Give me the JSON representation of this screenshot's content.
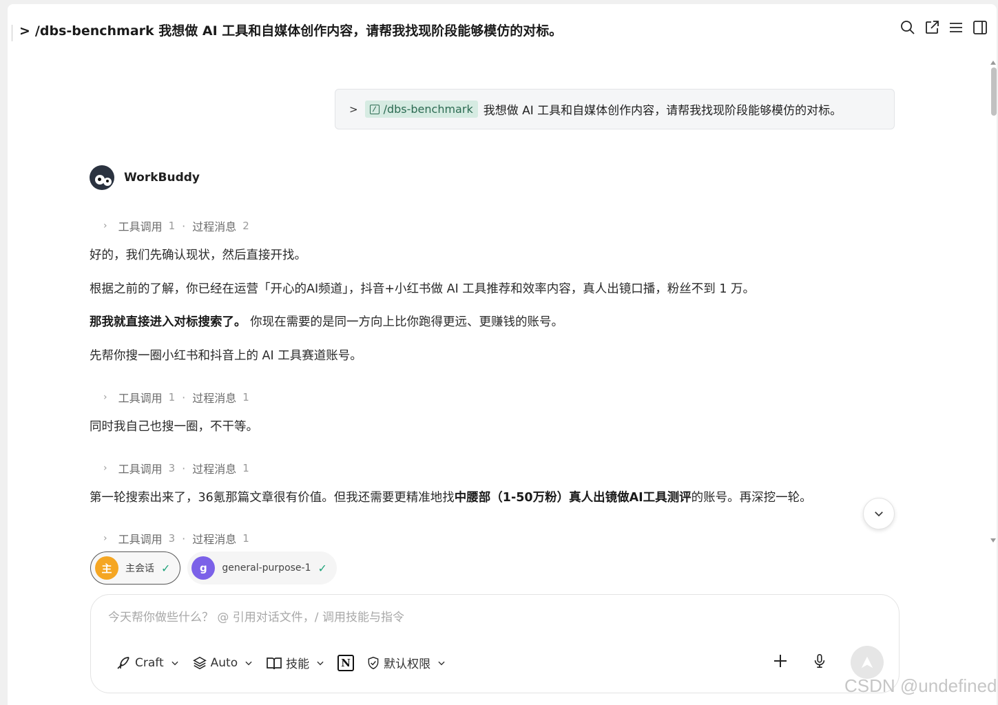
{
  "header": {
    "chevron": ">",
    "title": "/dbs-benchmark 我想做 AI 工具和自媒体创作内容，请帮我找现阶段能够模仿的对标。"
  },
  "top_icons": [
    "search-icon",
    "share-icon",
    "menu-icon",
    "panel-icon"
  ],
  "user_message": {
    "chevron": ">",
    "command": "/dbs-benchmark",
    "text": "我想做 AI 工具和自媒体创作内容，请帮我找现阶段能够模仿的对标。"
  },
  "agent": {
    "name": "WorkBuddy"
  },
  "tool_rows": [
    {
      "tool_label": "工具调用",
      "tool_count": "1",
      "sep": "·",
      "msg_label": "过程消息",
      "msg_count": "2"
    },
    {
      "tool_label": "工具调用",
      "tool_count": "1",
      "sep": "·",
      "msg_label": "过程消息",
      "msg_count": "1"
    },
    {
      "tool_label": "工具调用",
      "tool_count": "3",
      "sep": "·",
      "msg_label": "过程消息",
      "msg_count": "1"
    },
    {
      "tool_label": "工具调用",
      "tool_count": "3",
      "sep": "·",
      "msg_label": "过程消息",
      "msg_count": "1"
    }
  ],
  "paragraphs": {
    "p1": "好的，我们先确认现状，然后直接开找。",
    "p2": "根据之前的了解，你已经在运营「开心的AI频道」，抖音+小红书做 AI 工具推荐和效率内容，真人出镜口播，粉丝不到 1 万。",
    "p3_bold": "那我就直接进入对标搜索了。",
    "p3_rest": " 你现在需要的是同一方向上比你跑得更远、更赚钱的账号。",
    "p4": "先帮你搜一圈小红书和抖音上的 AI 工具赛道账号。",
    "p5": "同时我自己也搜一圈，不干等。",
    "p6_a": "第一轮搜索出来了，36氪那篇文章很有价值。但我还需要更精准地找",
    "p6_b": "中腰部（1-50万粉）真人出镜做AI工具测评",
    "p6_c": "的账号。再深挖一轮。"
  },
  "sessions": [
    {
      "badge": "主",
      "label": "主会话",
      "color": "#f5a623",
      "check": "✓"
    },
    {
      "badge": "g",
      "label": "general-purpose-1",
      "color": "#7b61e8",
      "check": "✓"
    }
  ],
  "composer": {
    "placeholder": "今天帮你做些什么？ @ 引用对话文件，/ 调用技能与指令",
    "mode": "Craft",
    "model": "Auto",
    "skills": "技能",
    "permission": "默认权限",
    "notion_letter": "N"
  },
  "watermark": "CSDN @undefined"
}
